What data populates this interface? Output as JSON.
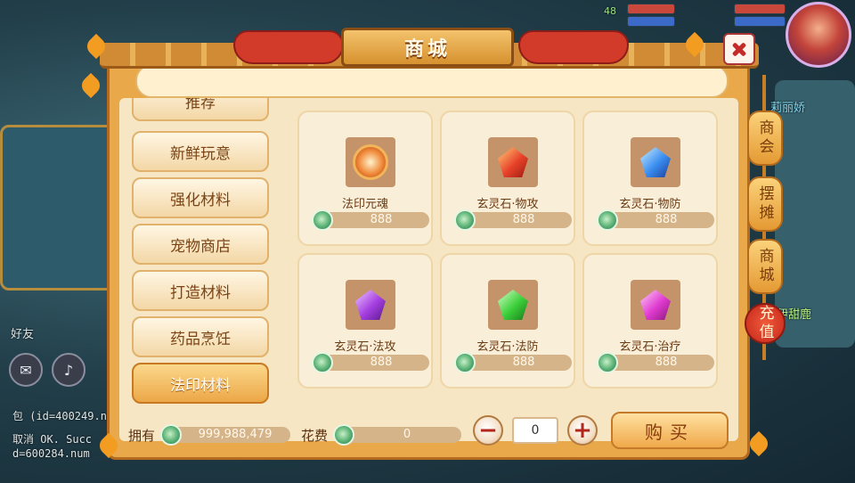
{
  "title": "商城",
  "categories": [
    {
      "label": "推荐",
      "active": false
    },
    {
      "label": "新鲜玩意",
      "active": false
    },
    {
      "label": "强化材料",
      "active": false
    },
    {
      "label": "宠物商店",
      "active": false
    },
    {
      "label": "打造材料",
      "active": false
    },
    {
      "label": "药品烹饪",
      "active": false
    },
    {
      "label": "法印材料",
      "active": true
    }
  ],
  "items": [
    {
      "name": "法印元魂",
      "price": "888",
      "icon": "orange-orb-icon",
      "color": "#f08a3a"
    },
    {
      "name": "玄灵石·物攻",
      "price": "888",
      "icon": "red-gem-icon",
      "color": "#e8432a"
    },
    {
      "name": "玄灵石·物防",
      "price": "888",
      "icon": "blue-gem-icon",
      "color": "#3a8ef0"
    },
    {
      "name": "玄灵石·法攻",
      "price": "888",
      "icon": "purple-gem-icon",
      "color": "#a43ee0"
    },
    {
      "name": "玄灵石·法防",
      "price": "888",
      "icon": "green-gem-icon",
      "color": "#3ccf3a"
    },
    {
      "name": "玄灵石·治疗",
      "price": "888",
      "icon": "magenta-gem-icon",
      "color": "#e03ad0"
    }
  ],
  "bottom": {
    "owned_label": "拥有",
    "owned_value": "999,988,479",
    "cost_label": "花费",
    "cost_value": "0",
    "quantity": "0",
    "minus_label": "−",
    "plus_label": "+",
    "buy_label": "购买"
  },
  "side_tabs": [
    "商会",
    "摆摊",
    "商城",
    "充值"
  ],
  "background": {
    "friends_label": "好友",
    "level_label": "48",
    "chat_line1": "包 (id=400249.n",
    "chat_line2": "取消 OK. Succ",
    "chat_line3": "d=600284.num",
    "npc1": "莉丽娇 ",
    "npc2": "伊甜鹿"
  }
}
